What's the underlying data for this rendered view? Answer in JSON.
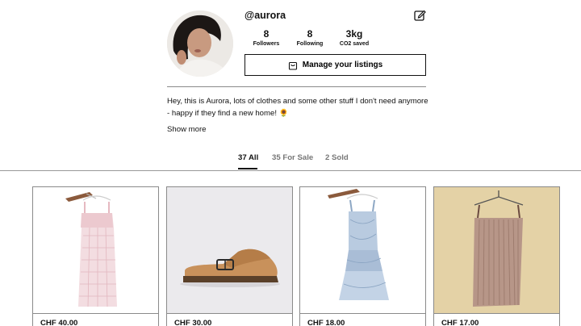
{
  "profile": {
    "username": "@aurora",
    "stats": [
      {
        "value": "8",
        "label": "Followers"
      },
      {
        "value": "8",
        "label": "Following"
      },
      {
        "value": "3kg",
        "label": "CO2 saved"
      }
    ],
    "manage_label": "Manage your listings",
    "bio": "Hey, this is Aurora, lots of clothes and some other stuff I don't need anymore - happy if they find a new home! 🌻",
    "show_more": "Show more"
  },
  "tabs": [
    {
      "label": "37 All",
      "active": true
    },
    {
      "label": "35 For Sale",
      "active": false
    },
    {
      "label": "2 Sold",
      "active": false
    }
  ],
  "listings": [
    {
      "price": "CHF 40.00",
      "item": "dress"
    },
    {
      "price": "CHF 30.00",
      "item": "clog"
    },
    {
      "price": "CHF 18.00",
      "item": "dress"
    },
    {
      "price": "CHF 17.00",
      "item": "dress"
    }
  ],
  "colors": {
    "accent": "#111111",
    "muted_tab": "#777777",
    "border": "#8a8a8a"
  }
}
